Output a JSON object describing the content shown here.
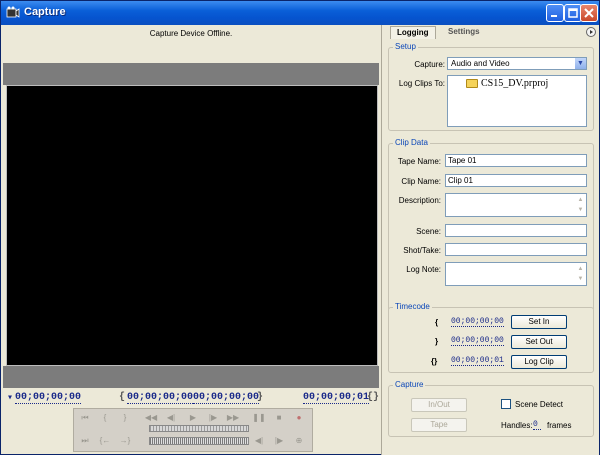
{
  "window": {
    "title": "Capture"
  },
  "monitor": {
    "status": "Capture Device Offline.",
    "timecode_current": "00;00;00;00",
    "timecode_in": "00;00;00;00",
    "timecode_out": "00;00;00;00",
    "timecode_duration": "00;00;00;01"
  },
  "tabs": [
    {
      "label": "Logging",
      "active": true
    },
    {
      "label": "Settings",
      "active": false
    }
  ],
  "setup": {
    "title": "Setup",
    "capture_label": "Capture:",
    "capture_value": "Audio and Video",
    "log_clips_label": "Log Clips To:",
    "project_name": "CS15_DV.prproj"
  },
  "clip_data": {
    "title": "Clip Data",
    "tape_name_label": "Tape Name:",
    "tape_name_value": "Tape 01",
    "clip_name_label": "Clip Name:",
    "clip_name_value": "Clip 01",
    "description_label": "Description:",
    "scene_label": "Scene:",
    "shot_take_label": "Shot/Take:",
    "log_note_label": "Log Note:"
  },
  "timecode": {
    "title": "Timecode",
    "in_value": "00;00;00;00",
    "out_value": "00;00;00;00",
    "duration_value": "00;00;00;01",
    "set_in_label": "Set In",
    "set_out_label": "Set Out",
    "log_clip_label": "Log Clip"
  },
  "capture": {
    "title": "Capture",
    "in_out_label": "In/Out",
    "tape_label": "Tape",
    "scene_detect_label": "Scene Detect",
    "handles_label": "Handles:",
    "handles_value": "0",
    "frames_label": "frames"
  }
}
